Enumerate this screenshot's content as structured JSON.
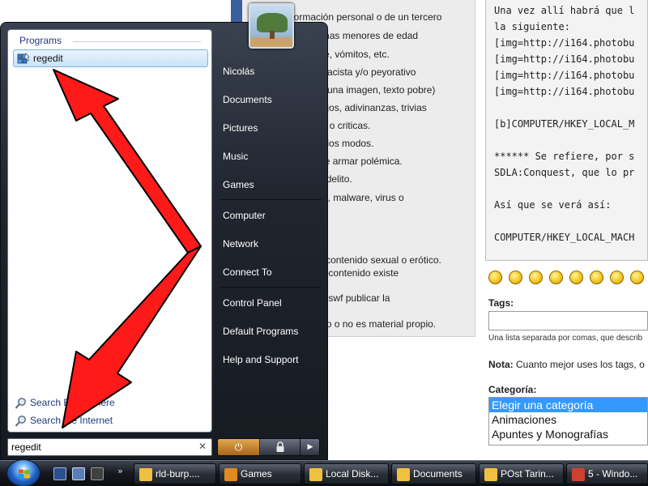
{
  "background_page": {
    "rules": [
      "información personal o de un tercero",
      "personas menores de edad",
      "sangre, vómitos, etc.",
      "racista y/o peyorativo",
      "(una imagen, texto pobre)",
      "chistes, acertijos, adivinanzas, trivias",
      "preguntas o criticas.",
      "de malos modos.",
      "con intención de armar polémica.",
      "algún delito.",
      "spyware, malware, virus o",
      "Si tu post contiene contenido sexual o erótico.",
      "Si cualquier tipo de contenido existe",
      "Si es un video o un swf publicar la",
      "Si es material propio o no es material propio."
    ],
    "code_lines": [
      "Una vez allí habrá que l",
      "la siguiente:",
      "[img=http://i164.photobu",
      "[img=http://i164.photobu",
      "[img=http://i164.photobu",
      "[img=http://i164.photobu",
      "",
      "[b]COMPUTER/HKEY_LOCAL_M",
      "",
      "****** Se refiere, por s",
      "SDLA:Conquest, que lo pr",
      "",
      "Así que se verá así:",
      "",
      "COMPUTER/HKEY_LOCAL_MACH"
    ],
    "emoticon_count": 10,
    "tags_label": "Tags:",
    "tags_help": "Una lista separada por comas, que describ",
    "note_label": "Nota:",
    "note_text": " Cuanto mejor uses los tags, o",
    "category_label": "Categoría:",
    "category_options": [
      "Elegir una categoría",
      "Animaciones",
      "Apuntes y Monografías"
    ],
    "category_selected_index": 0
  },
  "start_menu": {
    "programs_heading": "Programs",
    "program_result": "regedit",
    "search_links": [
      "Search Everywhere",
      "Search the Internet"
    ],
    "search_input_value": "regedit",
    "search_clear_glyph": "✕",
    "right_items": {
      "user": "Nicolás",
      "documents": "Documents",
      "pictures": "Pictures",
      "music": "Music",
      "games": "Games",
      "computer": "Computer",
      "network": "Network",
      "connect_to": "Connect To",
      "control_panel": "Control Panel",
      "default_programs": "Default Programs",
      "help_support": "Help and Support"
    },
    "power_glyph": "⏻",
    "lock_glyph": "🔒",
    "more_glyph": "▶"
  },
  "taskbar": {
    "quick_launch_chevron": "»",
    "tasks": [
      {
        "label": "rld-burp....",
        "icon_color": "#f0c040"
      },
      {
        "label": "Games",
        "icon_color": "#e08a20"
      },
      {
        "label": "Local Disk...",
        "icon_color": "#f0c040"
      },
      {
        "label": "Documents",
        "icon_color": "#f0c040"
      },
      {
        "label": "POst Tarin...",
        "icon_color": "#f0c040"
      },
      {
        "label": "5 - Windo...",
        "icon_color": "#d04030"
      }
    ]
  },
  "colors": {
    "arrow_fill": "#ff1a1a",
    "arrow_stroke": "#000000",
    "selection_blue": "#3399ff"
  }
}
